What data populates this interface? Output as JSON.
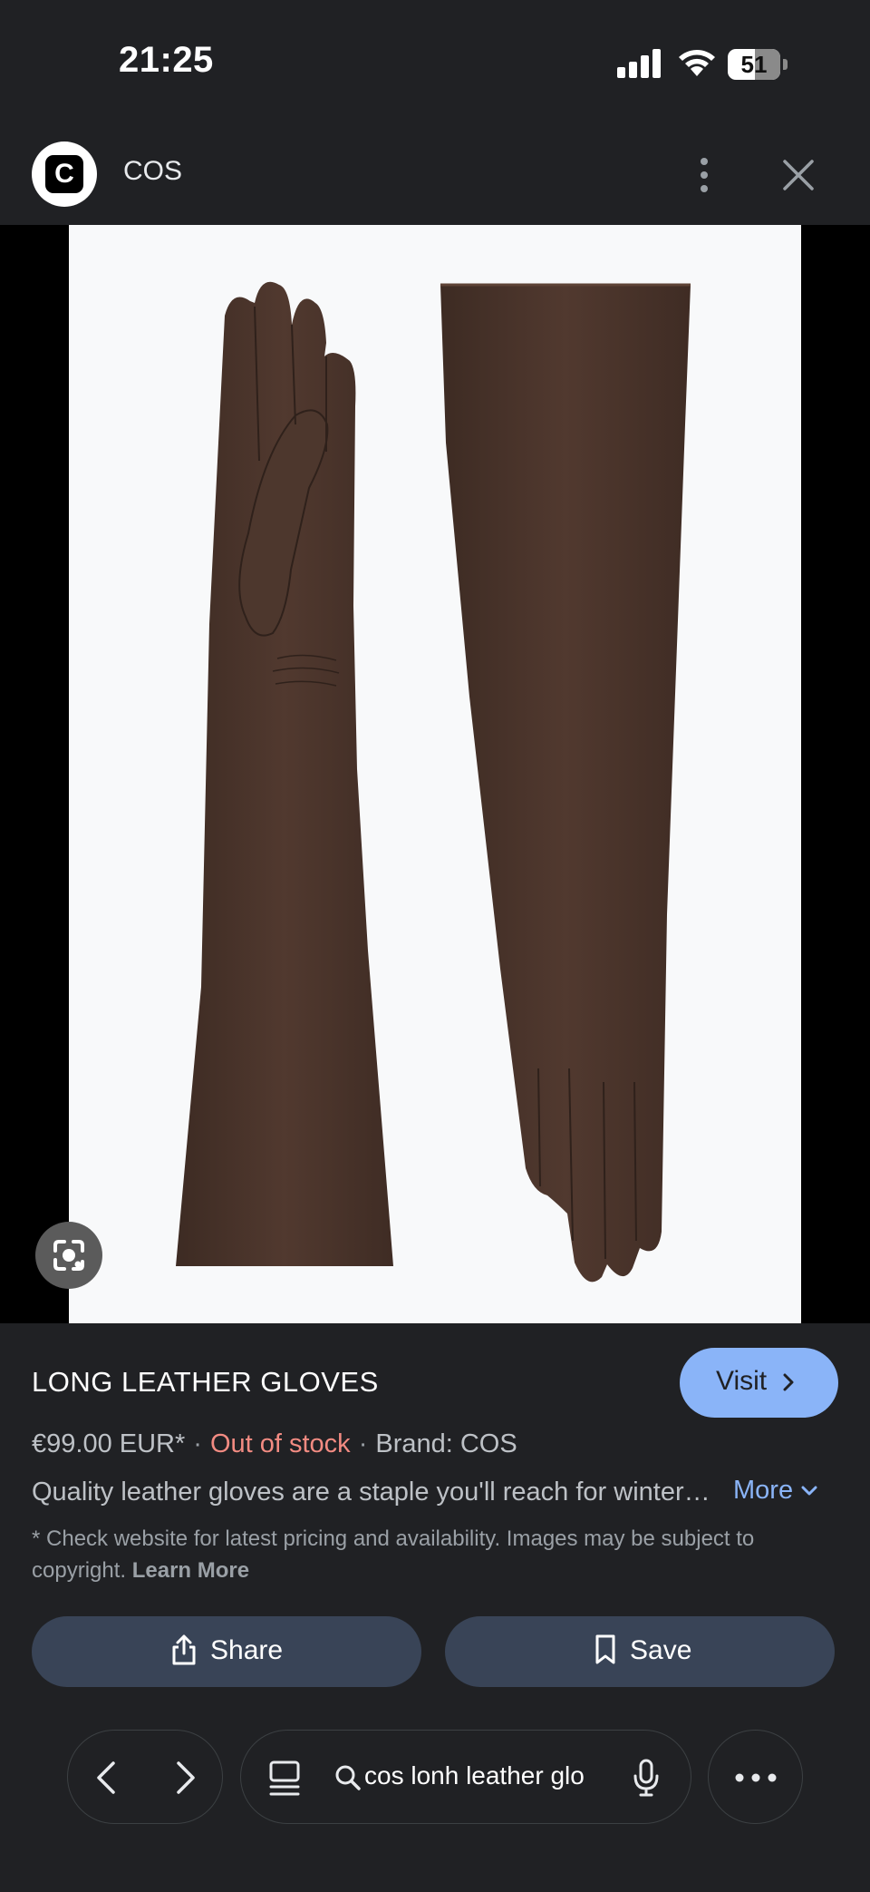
{
  "status_bar": {
    "time": "21:25",
    "battery": "51"
  },
  "header": {
    "site_name": "COS",
    "logo_letter": "C"
  },
  "product": {
    "title": "LONG LEATHER GLOVES",
    "visit_label": "Visit",
    "price": "€99.00 EUR*",
    "stock": "Out of stock",
    "brand": "Brand: COS",
    "description": "Quality leather gloves are a staple you'll reach for winter after winter.",
    "more_label": "More",
    "disclaimer": "* Check website for latest pricing and availability. Images may be subject to copyright.",
    "learn_more": "Learn More",
    "colors": {
      "leather": "#4a342b",
      "stock": "#f28b82",
      "accent": "#8ab4f8"
    }
  },
  "actions": {
    "share_label": "Share",
    "save_label": "Save"
  },
  "toolbar": {
    "search_text": "cos lonh leather glo"
  },
  "icons": [
    "signal-icon",
    "wifi-icon",
    "battery-icon",
    "more-vert-icon",
    "close-icon",
    "lens-icon",
    "chevron-right-icon",
    "chevron-down-icon",
    "share-icon",
    "bookmark-icon",
    "back-icon",
    "forward-icon",
    "tabs-icon",
    "search-icon",
    "mic-icon",
    "more-horiz-icon"
  ]
}
